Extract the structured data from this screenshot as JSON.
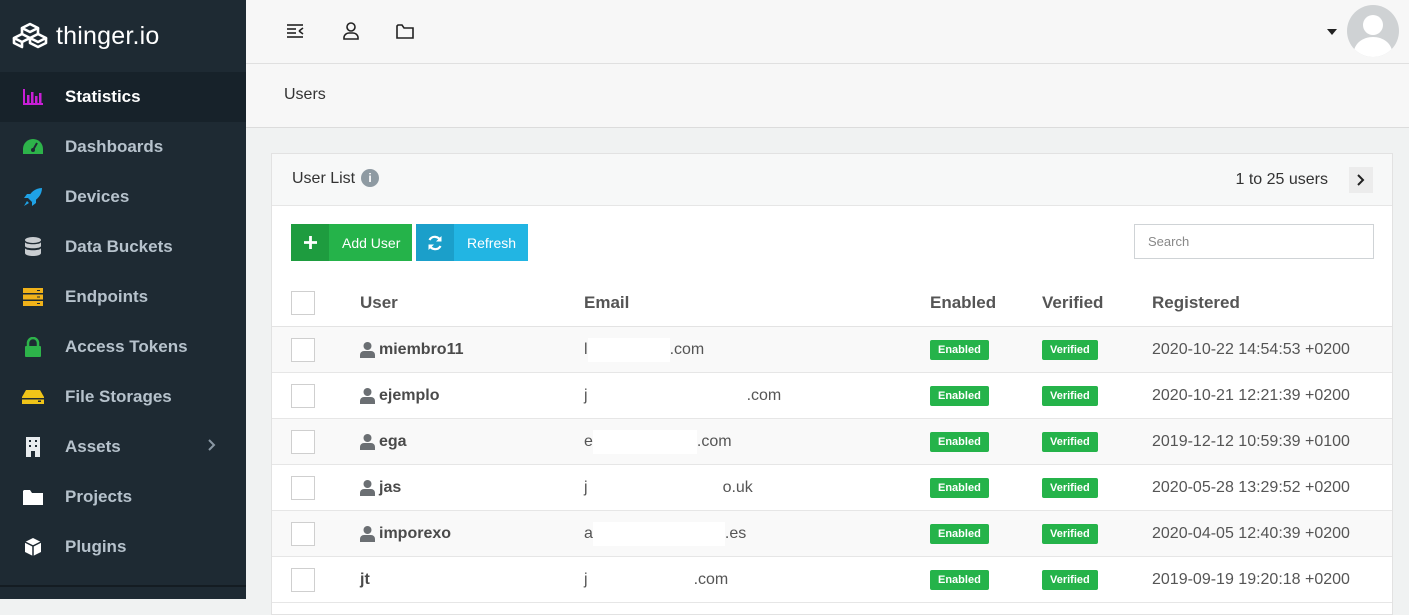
{
  "brand": {
    "name": "thinger.io"
  },
  "sidebar": {
    "items": [
      {
        "label": "Statistics",
        "icon": "bar-chart-icon",
        "color": "#c81fd6"
      },
      {
        "label": "Dashboards",
        "icon": "gauge-icon",
        "color": "#2db34a"
      },
      {
        "label": "Devices",
        "icon": "rocket-icon",
        "color": "#1fa2e6"
      },
      {
        "label": "Data Buckets",
        "icon": "database-icon",
        "color": "#c9cdd1"
      },
      {
        "label": "Endpoints",
        "icon": "server-icon",
        "color": "#f0b21a"
      },
      {
        "label": "Access Tokens",
        "icon": "lock-icon",
        "color": "#2db34a"
      },
      {
        "label": "File Storages",
        "icon": "hard-drive-icon",
        "color": "#f0c419"
      },
      {
        "label": "Assets",
        "icon": "building-icon",
        "color": "#e8ecef"
      },
      {
        "label": "Projects",
        "icon": "folder-icon",
        "color": "#ffffff"
      },
      {
        "label": "Plugins",
        "icon": "cube-icon",
        "color": "#ffffff"
      }
    ]
  },
  "breadcrumb": {
    "current": "Users"
  },
  "panel": {
    "title": "User List",
    "count": "1 to 25 users",
    "add_label": "Add User",
    "refresh_label": "Refresh",
    "search_placeholder": "Search"
  },
  "table": {
    "headers": {
      "user": "User",
      "email": "Email",
      "enabled": "Enabled",
      "verified": "Verified",
      "registered": "Registered"
    },
    "rows": [
      {
        "user": "miembro11",
        "email_start": "l",
        "email_end": ".com",
        "enabled": "Enabled",
        "verified": "Verified",
        "registered": "2020-10-22 14:54:53 +0200"
      },
      {
        "user": "ejemplo",
        "email_start": "j",
        "email_end": ".com",
        "enabled": "Enabled",
        "verified": "Verified",
        "registered": "2020-10-21 12:21:39 +0200"
      },
      {
        "user": "ega",
        "email_start": "e",
        "email_end": ".com",
        "enabled": "Enabled",
        "verified": "Verified",
        "registered": "2019-12-12 10:59:39 +0100"
      },
      {
        "user": "jas",
        "email_start": "j",
        "email_end": "o.uk",
        "enabled": "Enabled",
        "verified": "Verified",
        "registered": "2020-05-28 13:29:52 +0200"
      },
      {
        "user": "imporexo",
        "email_start": "a",
        "email_end": ".es",
        "enabled": "Enabled",
        "verified": "Verified",
        "registered": "2020-04-05 12:40:39 +0200"
      },
      {
        "user": "jt",
        "email_start": "j",
        "email_end": ".com",
        "enabled": "Enabled",
        "verified": "Verified",
        "registered": "2019-09-19 19:20:18 +0200"
      }
    ]
  }
}
